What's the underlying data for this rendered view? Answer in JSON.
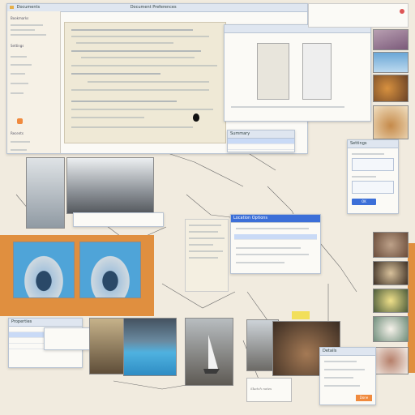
{
  "colors": {
    "orange": "#e08f3f",
    "canvas": "#f1ebdf",
    "accent": "#3c6fd8",
    "title_blue": "#dfe6f0"
  },
  "icons": [
    "folder-icon",
    "close-icon",
    "cursor-icon",
    "arrow-icon",
    "image-icon"
  ],
  "top_window": {
    "title": "Documents",
    "breadcrumb": "Document Preferences"
  },
  "left_sidebar": {
    "labels": [
      "Bookmarks",
      "Settings",
      "Recents"
    ]
  },
  "dialog_list": {
    "title": "Summary"
  },
  "right_panel": {
    "title": "Settings",
    "button": "OK"
  },
  "mid_dialog": {
    "title": "Location Options"
  },
  "side_dialog": {
    "title": "Properties"
  },
  "bottom_right_dialog": {
    "title": "Details",
    "button": "Done"
  },
  "note": {
    "text": "Sketch notes"
  }
}
